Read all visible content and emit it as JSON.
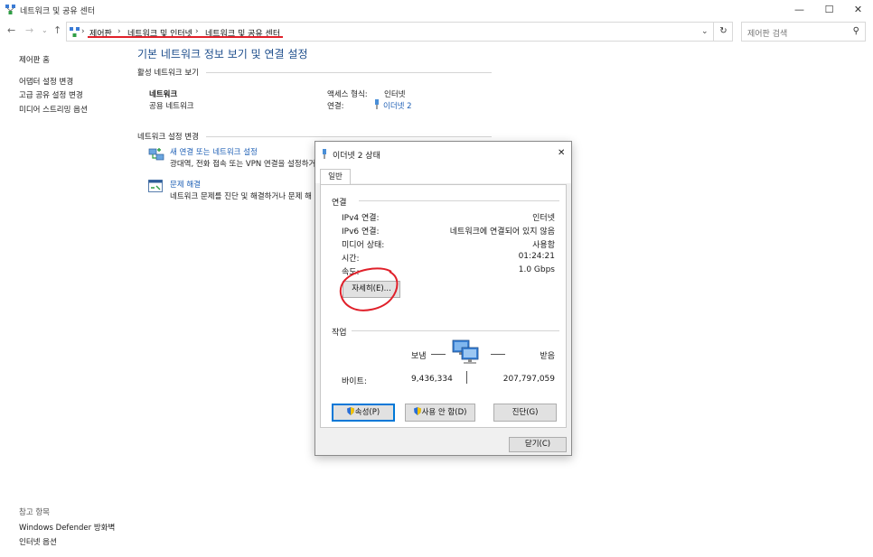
{
  "window": {
    "title": "네트워크 및 공유 센터",
    "controls": {
      "minimize": "—",
      "maximize": "☐",
      "close": "✕"
    }
  },
  "nav": {
    "back": "←",
    "forward": "→",
    "recent": "⌄",
    "up": "↑",
    "breadcrumb_sep": "›",
    "breadcrumbs": [
      "제어판",
      "네트워크 및 인터넷",
      "네트워크 및 공유 센터"
    ],
    "dropdown": "⌄",
    "refresh": "↻",
    "search_placeholder": "제어판 검색",
    "search_icon": "⚲"
  },
  "left_pane": {
    "home": "제어판 홈",
    "links": [
      "어댑터 설정 변경",
      "고급 공유 설정 변경",
      "미디어 스트리밍 옵션"
    ],
    "see_also_title": "참고 항목",
    "see_also": [
      "Windows Defender 방화벽",
      "인터넷 옵션"
    ]
  },
  "main": {
    "heading": "기본 네트워크 정보 보기 및 연결 설정",
    "active_networks_title": "활성 네트워크 보기",
    "network_name": "네트워크",
    "network_type": "공용 네트워크",
    "access_type_label": "액세스 형식:",
    "access_type_value": "인터넷",
    "connections_label": "연결:",
    "connections_value": "이더넷 2",
    "change_settings_title": "네트워크 설정 변경",
    "new_conn_link": "새 연결 또는 네트워크 설정",
    "new_conn_desc": "광대역, 전화 접속 또는 VPN 연결을 설정하거",
    "troubleshoot_link": "문제 해결",
    "troubleshoot_desc": "네트워크 문제를 진단 및 해결하거나 문제 해"
  },
  "dialog": {
    "title": "이더넷 2 상태",
    "close": "✕",
    "tab": "일반",
    "connection_title": "연결",
    "rows": [
      {
        "label": "IPv4 연결:",
        "value": "인터넷"
      },
      {
        "label": "IPv6 연결:",
        "value": "네트워크에 연결되어 있지 않음"
      },
      {
        "label": "미디어 상태:",
        "value": "사용함"
      },
      {
        "label": "시간:",
        "value": "01:24:21"
      },
      {
        "label": "속도:",
        "value": "1.0 Gbps"
      }
    ],
    "details_button": "자세히(E)...",
    "activity_title": "작업",
    "sent_label": "보냄",
    "received_label": "받음",
    "bytes_label": "바이트:",
    "bytes_sent": "9,436,334",
    "bytes_received": "207,797,059",
    "properties_button": "속성(P)",
    "disable_button": "사용 안 함(D)",
    "diagnose_button": "진단(G)",
    "close_button": "닫기(C)"
  },
  "colors": {
    "link": "#1e5fb5",
    "heading": "#1e4e8c",
    "annotation": "#e0202a",
    "focus": "#0078d7"
  }
}
